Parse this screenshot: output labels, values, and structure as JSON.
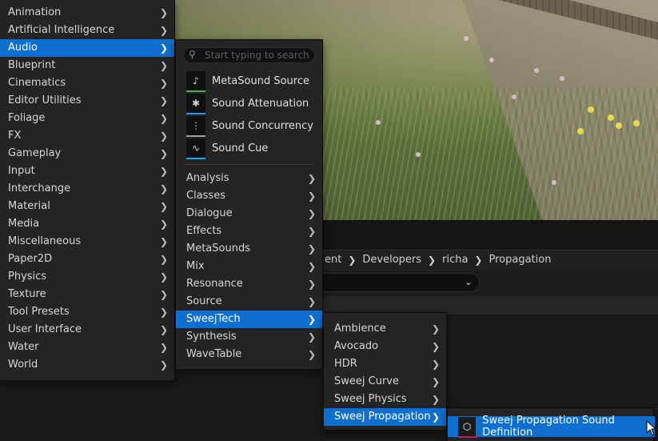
{
  "breadcrumb": [
    "ent",
    "Developers",
    "richa",
    "Propagation"
  ],
  "menu_main": {
    "items": [
      {
        "label": "Animation",
        "has_submenu": true
      },
      {
        "label": "Artificial Intelligence",
        "has_submenu": true
      },
      {
        "label": "Audio",
        "has_submenu": true,
        "active": true
      },
      {
        "label": "Blueprint",
        "has_submenu": true
      },
      {
        "label": "Cinematics",
        "has_submenu": true
      },
      {
        "label": "Editor Utilities",
        "has_submenu": true
      },
      {
        "label": "Foliage",
        "has_submenu": true
      },
      {
        "label": "FX",
        "has_submenu": true
      },
      {
        "label": "Gameplay",
        "has_submenu": true
      },
      {
        "label": "Input",
        "has_submenu": true
      },
      {
        "label": "Interchange",
        "has_submenu": true
      },
      {
        "label": "Material",
        "has_submenu": true
      },
      {
        "label": "Media",
        "has_submenu": true
      },
      {
        "label": "Miscellaneous",
        "has_submenu": true
      },
      {
        "label": "Paper2D",
        "has_submenu": true
      },
      {
        "label": "Physics",
        "has_submenu": true
      },
      {
        "label": "Texture",
        "has_submenu": true
      },
      {
        "label": "Tool Presets",
        "has_submenu": true
      },
      {
        "label": "User Interface",
        "has_submenu": true
      },
      {
        "label": "Water",
        "has_submenu": true
      },
      {
        "label": "World",
        "has_submenu": true
      }
    ]
  },
  "menu_audio": {
    "search_placeholder": "Start typing to search",
    "assets": [
      {
        "label": "MetaSound Source",
        "icon": "metasound-icon",
        "color": "#4caf50"
      },
      {
        "label": "Sound Attenuation",
        "icon": "attenuation-icon",
        "color": "#2196f3"
      },
      {
        "label": "Sound Concurrency",
        "icon": "concurrency-icon",
        "color": "#9e9e9e"
      },
      {
        "label": "Sound Cue",
        "icon": "sound-cue-icon",
        "color": "#03a9f4"
      }
    ],
    "items": [
      {
        "label": "Analysis",
        "has_submenu": true
      },
      {
        "label": "Classes",
        "has_submenu": true
      },
      {
        "label": "Dialogue",
        "has_submenu": true
      },
      {
        "label": "Effects",
        "has_submenu": true
      },
      {
        "label": "MetaSounds",
        "has_submenu": true
      },
      {
        "label": "Mix",
        "has_submenu": true
      },
      {
        "label": "Resonance",
        "has_submenu": true
      },
      {
        "label": "Source",
        "has_submenu": true
      },
      {
        "label": "SweejTech",
        "has_submenu": true,
        "active": true
      },
      {
        "label": "Synthesis",
        "has_submenu": true
      },
      {
        "label": "WaveTable",
        "has_submenu": true
      }
    ]
  },
  "menu_sweejtech": {
    "items": [
      {
        "label": "Ambience",
        "has_submenu": true
      },
      {
        "label": "Avocado",
        "has_submenu": true
      },
      {
        "label": "HDR",
        "has_submenu": true
      },
      {
        "label": "Sweej Curve",
        "has_submenu": true
      },
      {
        "label": "Sweej Physics",
        "has_submenu": true
      },
      {
        "label": "Sweej Propagation",
        "has_submenu": true,
        "active": true
      }
    ]
  },
  "menu_propagation": {
    "item_label": "Sweej Propagation Sound Definition",
    "icon": "sound-definition-icon"
  },
  "colors": {
    "accent": "#0f6fd0",
    "menu_bg": "#242424"
  }
}
